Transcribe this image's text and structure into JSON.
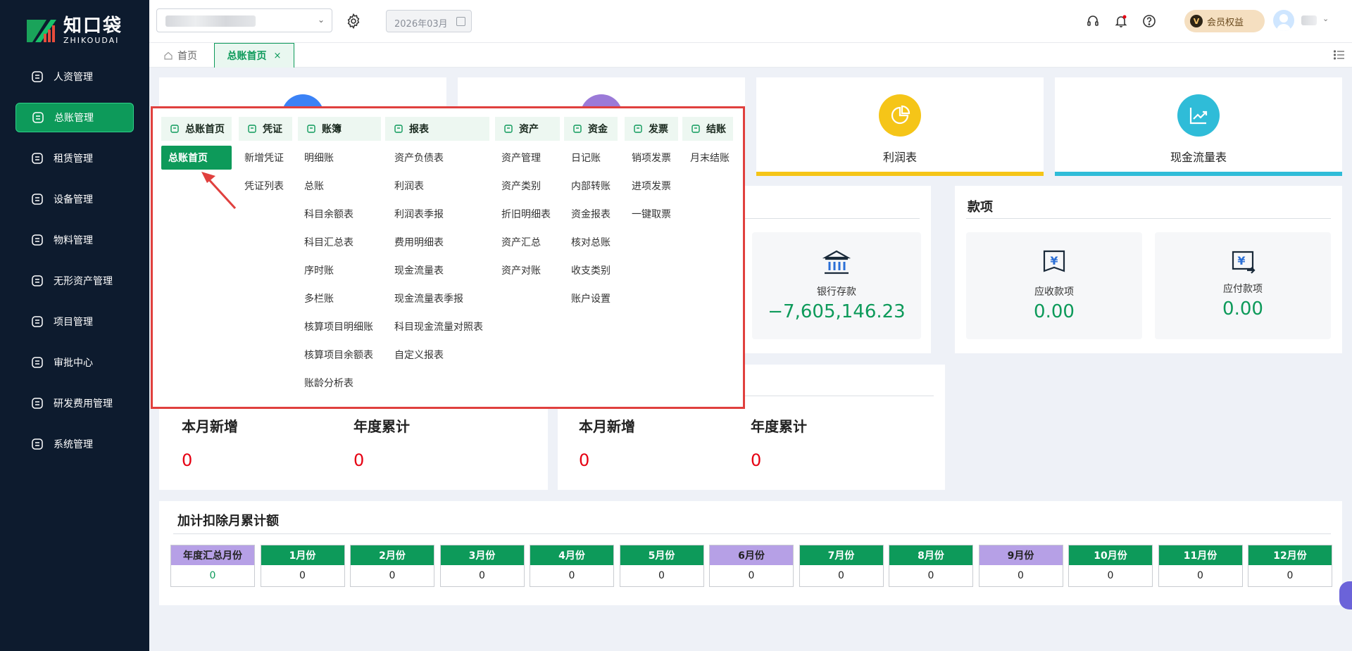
{
  "brand": {
    "cn": "知口袋",
    "en": "ZHIKOUDAI"
  },
  "sidebar": {
    "items": [
      {
        "label": "人资管理",
        "icon": "person-icon"
      },
      {
        "label": "总账管理",
        "icon": "ledger-icon",
        "active": true
      },
      {
        "label": "租赁管理",
        "icon": "lease-icon"
      },
      {
        "label": "设备管理",
        "icon": "device-icon"
      },
      {
        "label": "物料管理",
        "icon": "material-icon"
      },
      {
        "label": "无形资产管理",
        "icon": "intangible-icon"
      },
      {
        "label": "项目管理",
        "icon": "project-icon"
      },
      {
        "label": "审批中心",
        "icon": "approval-icon"
      },
      {
        "label": "研发费用管理",
        "icon": "rd-icon"
      },
      {
        "label": "系统管理",
        "icon": "gear-icon"
      }
    ]
  },
  "header": {
    "date": "2026年03月",
    "vip_label": "会员权益",
    "vip_badge": "V"
  },
  "tabs": {
    "home": "首页",
    "active": "总账首页",
    "close": "×"
  },
  "top_stats": [
    {
      "label": "利润表",
      "color": "#f5c518"
    },
    {
      "label": "现金流量表",
      "color": "#2fbcd8"
    }
  ],
  "funds_panel": {
    "bank": {
      "label": "银行存款",
      "value": "−7,605,146.23"
    }
  },
  "payables_panel": {
    "title": "款项",
    "receivable": {
      "label": "应收款项",
      "value": "0.00"
    },
    "payable": {
      "label": "应付款项",
      "value": "0.00"
    }
  },
  "counters": [
    {
      "title": "本月新增",
      "value": "0"
    },
    {
      "title": "年度累计",
      "value": "0"
    },
    {
      "title": "本月新增",
      "value": "0"
    },
    {
      "title": "年度累计",
      "value": "0"
    }
  ],
  "deduction": {
    "title": "加计扣除月累计额",
    "columns": [
      {
        "label": "年度汇总月份",
        "value": "0",
        "style": "purple",
        "green": true
      },
      {
        "label": "1月份",
        "value": "0"
      },
      {
        "label": "2月份",
        "value": "0"
      },
      {
        "label": "3月份",
        "value": "0"
      },
      {
        "label": "4月份",
        "value": "0"
      },
      {
        "label": "5月份",
        "value": "0"
      },
      {
        "label": "6月份",
        "value": "0",
        "style": "purple"
      },
      {
        "label": "7月份",
        "value": "0"
      },
      {
        "label": "8月份",
        "value": "0"
      },
      {
        "label": "9月份",
        "value": "0",
        "style": "purple"
      },
      {
        "label": "10月份",
        "value": "0"
      },
      {
        "label": "11月份",
        "value": "0"
      },
      {
        "label": "12月份",
        "value": "0"
      }
    ]
  },
  "mega_menu": {
    "groups": [
      {
        "head": "总账首页",
        "items": [
          "总账首页"
        ]
      },
      {
        "head": "凭证",
        "items": [
          "新增凭证",
          "凭证列表"
        ]
      },
      {
        "head": "账簿",
        "items": [
          "明细账",
          "总账",
          "科目余额表",
          "科目汇总表",
          "序时账",
          "多栏账",
          "核算项目明细账",
          "核算项目余额表",
          "账龄分析表"
        ]
      },
      {
        "head": "报表",
        "items": [
          "资产负债表",
          "利润表",
          "利润表季报",
          "费用明细表",
          "现金流量表",
          "现金流量表季报",
          "科目现金流量对照表",
          "自定义报表"
        ]
      },
      {
        "head": "资产",
        "items": [
          "资产管理",
          "资产类别",
          "折旧明细表",
          "资产汇总",
          "资产对账"
        ]
      },
      {
        "head": "资金",
        "items": [
          "日记账",
          "内部转账",
          "资金报表",
          "核对总账",
          "收支类别",
          "账户设置"
        ]
      },
      {
        "head": "发票",
        "items": [
          "销项发票",
          "进项发票",
          "一键取票"
        ]
      },
      {
        "head": "结账",
        "items": [
          "月末结账"
        ]
      }
    ]
  }
}
